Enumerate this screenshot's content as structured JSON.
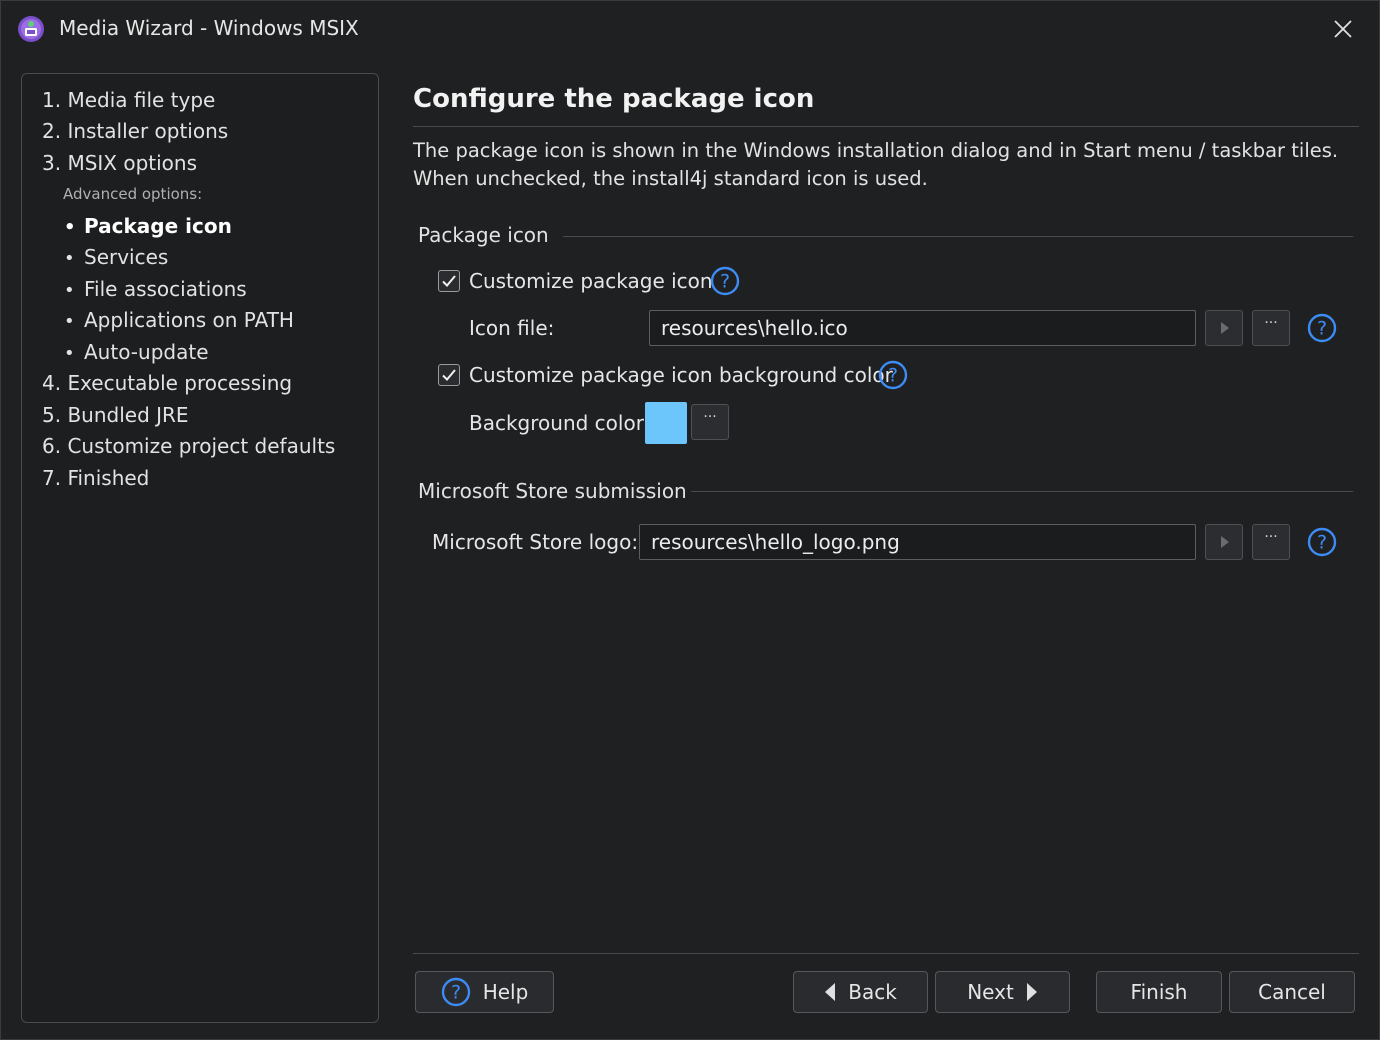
{
  "window": {
    "title": "Media Wizard - Windows MSIX"
  },
  "steps": {
    "items": [
      "1. Media file type",
      "2. Installer options",
      "3. MSIX options",
      "4. Executable processing",
      "5. Bundled JRE",
      "6. Customize project defaults",
      "7. Finished"
    ],
    "advanced_label": "Advanced options:",
    "sub_items": [
      {
        "label": "Package icon",
        "active": true
      },
      {
        "label": "Services",
        "active": false
      },
      {
        "label": "File associations",
        "active": false
      },
      {
        "label": "Applications on PATH",
        "active": false
      },
      {
        "label": "Auto-update",
        "active": false
      }
    ],
    "bullet": "•"
  },
  "main": {
    "title": "Configure the package icon",
    "description": "The package icon is shown in the Windows installation dialog and in Start menu / taskbar tiles. When unchecked, the install4j standard icon is used.",
    "package_icon_section": {
      "label": "Package icon",
      "customize_icon": {
        "label": "Customize package icon",
        "checked": true
      },
      "icon_file": {
        "label": "Icon file:",
        "value": "resources\\hello.ico"
      },
      "customize_bg": {
        "label": "Customize package icon background color",
        "checked": true
      },
      "background_color": {
        "label": "Background color:",
        "value": "#6cc6fb"
      }
    },
    "store_section": {
      "label": "Microsoft Store submission",
      "store_logo": {
        "label": "Microsoft Store logo:",
        "value": "resources\\hello_logo.png"
      }
    },
    "browse_label": "···"
  },
  "buttons": {
    "help": "Help",
    "back": "Back",
    "next": "Next",
    "finish": "Finish",
    "cancel": "Cancel"
  },
  "colors": {
    "accent_help": "#3d8cf5",
    "background": "#1f2022"
  }
}
